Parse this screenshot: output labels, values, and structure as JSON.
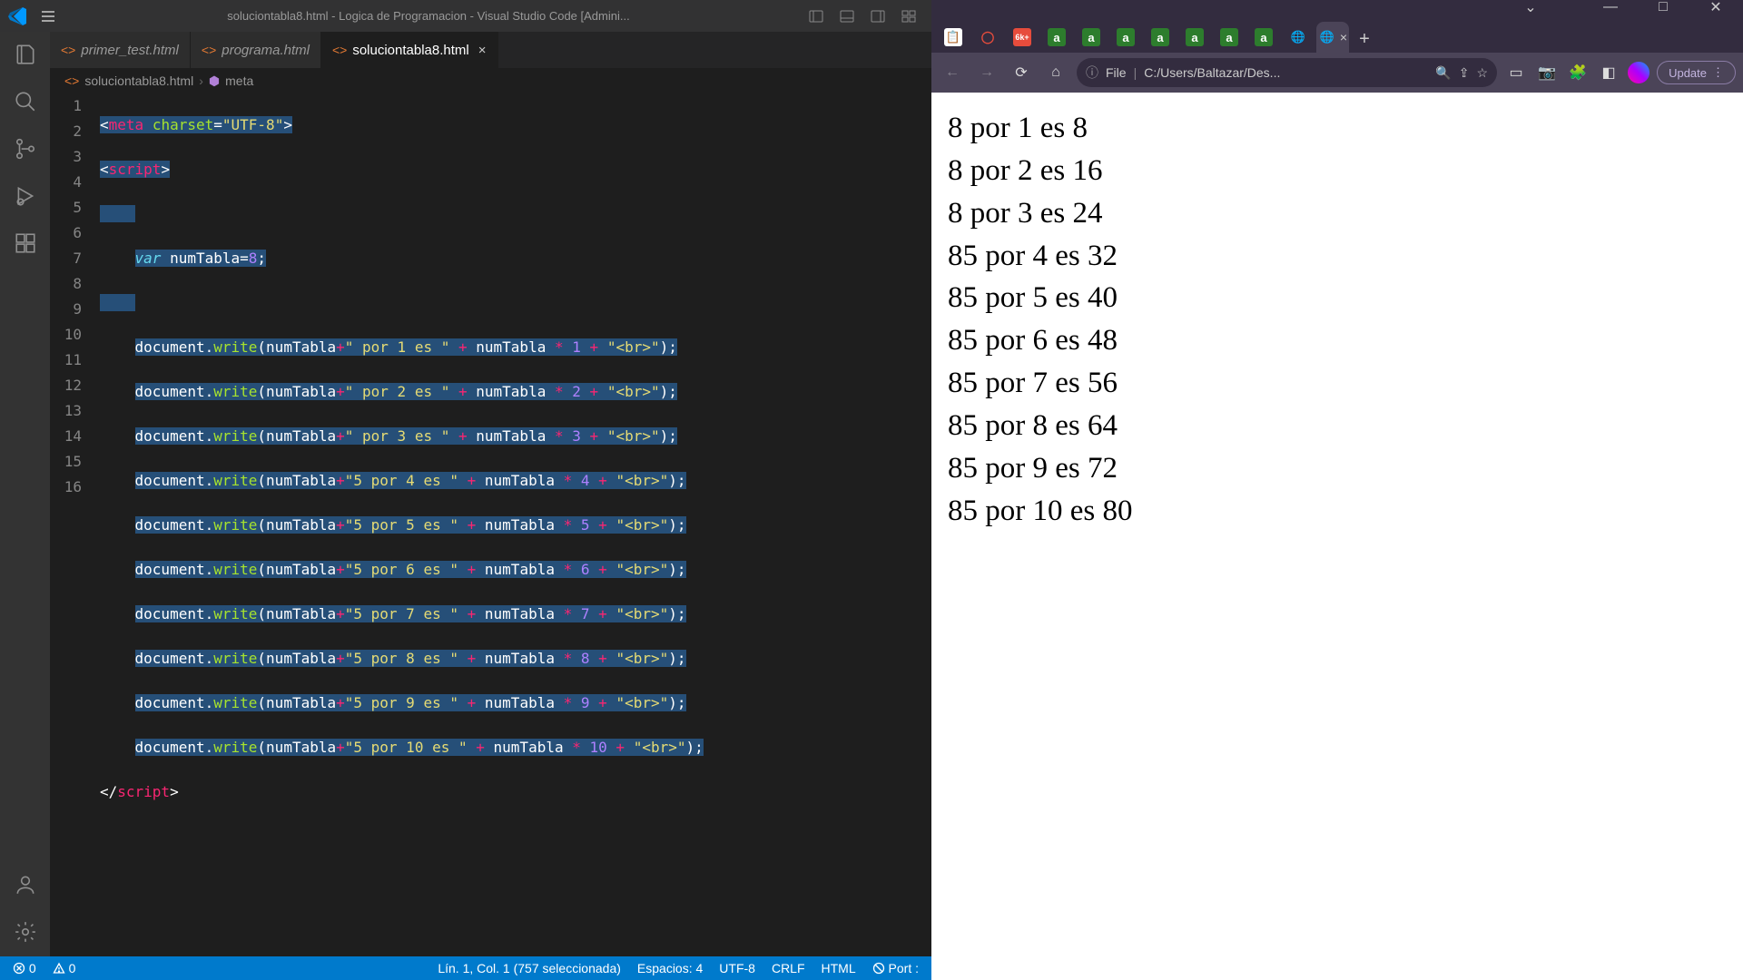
{
  "vscode": {
    "title": "soluciontabla8.html - Logica de Programacion - Visual Studio Code [Admini...",
    "tabs": [
      {
        "name": "primer_test.html",
        "active": false,
        "dirty": false
      },
      {
        "name": "programa.html",
        "active": false,
        "dirty": false
      },
      {
        "name": "soluciontabla8.html",
        "active": true,
        "dirty": false
      }
    ],
    "breadcrumb": {
      "file": "soluciontabla8.html",
      "symbol": "meta"
    },
    "lineNumbers": [
      "1",
      "2",
      "3",
      "4",
      "5",
      "6",
      "7",
      "8",
      "9",
      "10",
      "11",
      "12",
      "13",
      "14",
      "15",
      "16"
    ],
    "statusbar": {
      "errors": "0",
      "warnings": "0",
      "cursor": "Lín. 1, Col. 1 (757 seleccionada)",
      "spaces": "Espacios: 4",
      "encoding": "UTF-8",
      "eol": "CRLF",
      "language": "HTML",
      "port": "Port :"
    }
  },
  "browser": {
    "urlLabel": "File",
    "url": "C:/Users/Baltazar/Des...",
    "updateLabel": "Update",
    "tabFavicons": [
      "📋",
      "⭕",
      "🔵",
      "a",
      "a",
      "a",
      "a",
      "a",
      "a",
      "a",
      "🌐",
      "🌐"
    ],
    "output": [
      "8 por 1 es 8",
      "8 por 2 es 16",
      "8 por 3 es 24",
      "85 por 4 es 32",
      "85 por 5 es 40",
      "85 por 6 es 48",
      "85 por 7 es 56",
      "85 por 8 es 64",
      "85 por 9 es 72",
      "85 por 10 es 80"
    ]
  }
}
